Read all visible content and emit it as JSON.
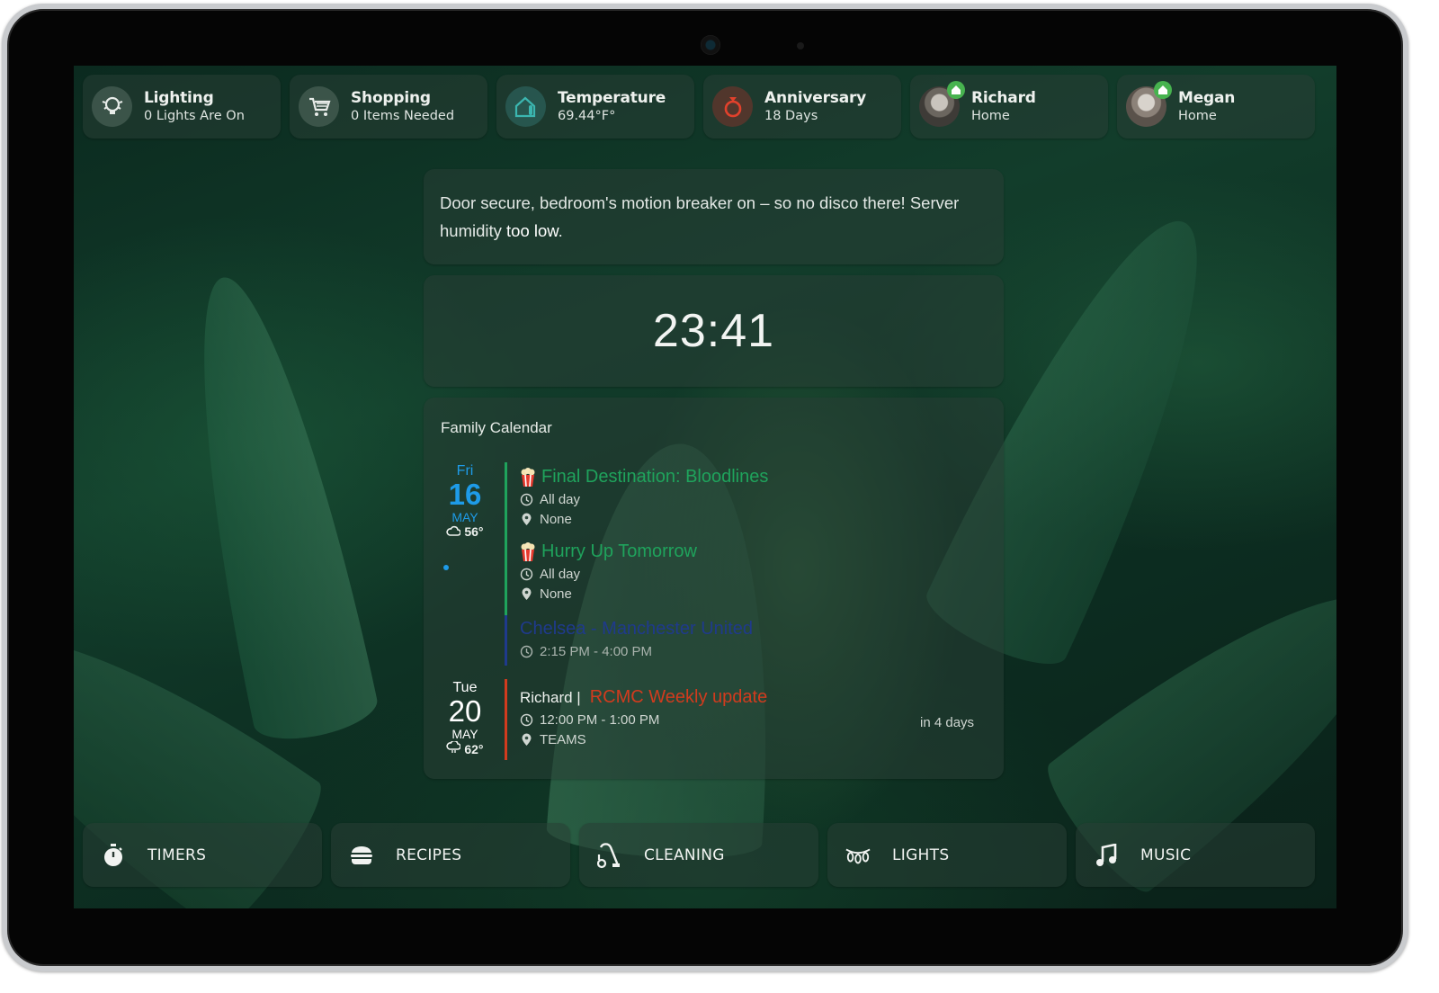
{
  "badges": [
    {
      "title": "Lighting",
      "subtitle": "0 Lights Are On",
      "icon": "light-bulbs-icon"
    },
    {
      "title": "Shopping",
      "subtitle": "0 Items Needed",
      "icon": "cart-icon"
    },
    {
      "title": "Temperature",
      "subtitle": "69.44°F°",
      "icon": "home-thermometer-icon"
    },
    {
      "title": "Anniversary",
      "subtitle": "18 Days",
      "icon": "ring-icon"
    },
    {
      "title": "Richard",
      "subtitle": "Home",
      "icon": "avatar"
    },
    {
      "title": "Megan",
      "subtitle": "Home",
      "icon": "avatar"
    }
  ],
  "message": {
    "text": "Door secure, bedroom's motion breaker on – so no disco there! Server humidity ",
    "emphasis": "too low",
    "end": "."
  },
  "clock": {
    "time": "23:41"
  },
  "calendar": {
    "title": "Family Calendar",
    "days": [
      {
        "dow": "Fri",
        "num": "16",
        "month": "MAY",
        "weather": "56°",
        "weather_icon": "cloud-icon",
        "color": "#1e9be8"
      },
      {
        "dow": "Tue",
        "num": "20",
        "month": "MAY",
        "weather": "62°",
        "weather_icon": "cloud-rain-icon",
        "color": "#ffffff"
      }
    ],
    "events": [
      {
        "title": "Final Destination: Bloodlines",
        "time": "All day",
        "location": "None",
        "color": "#1fa35c"
      },
      {
        "title": "Hurry Up Tomorrow",
        "time": "All day",
        "location": "None",
        "color": "#1fa35c"
      },
      {
        "title": "Chelsea - Manchester United",
        "time": "2:15 PM - 4:00 PM",
        "color": "#1f3a8c"
      },
      {
        "owner": "Richard |",
        "title": "RCMC Weekly update",
        "time": "12:00 PM - 1:00 PM",
        "location": "TEAMS",
        "relative": "in 4 days",
        "color": "#d13b1e"
      }
    ]
  },
  "buttons": [
    {
      "label": "TIMERS",
      "icon": "stopwatch-icon"
    },
    {
      "label": "RECIPES",
      "icon": "burger-icon"
    },
    {
      "label": "CLEANING",
      "icon": "vacuum-icon"
    },
    {
      "label": "LIGHTS",
      "icon": "string-lights-icon"
    },
    {
      "label": "MUSIC",
      "icon": "music-note-icon"
    }
  ],
  "colors": {
    "accent_blue": "#1e9be8",
    "event_green": "#1fa35c",
    "event_red": "#d13b1e",
    "event_navy": "#1f3a8c",
    "presence_green": "#47b34f"
  }
}
